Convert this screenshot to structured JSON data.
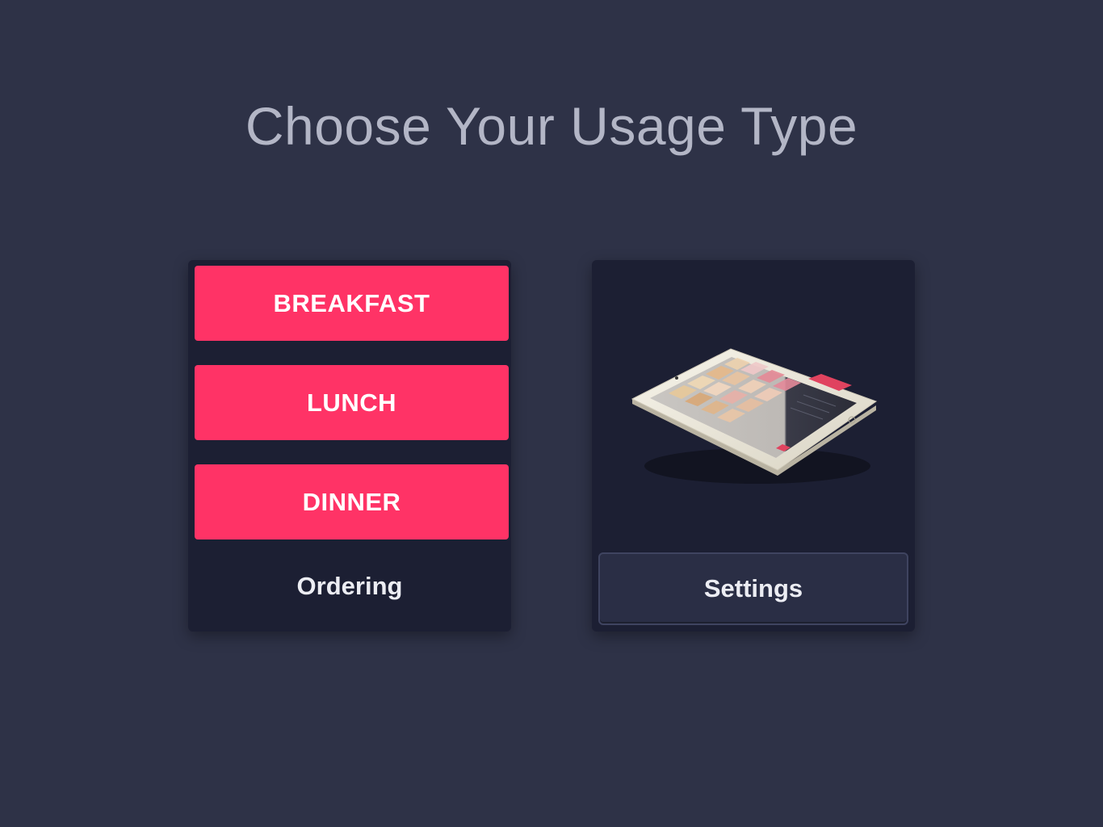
{
  "header": {
    "title": "Choose Your Usage Type"
  },
  "ordering": {
    "buttons": [
      {
        "label": "BREAKFAST"
      },
      {
        "label": "LUNCH"
      },
      {
        "label": "DINNER"
      }
    ],
    "caption": "Ordering"
  },
  "settings": {
    "image": "tablet-illustration",
    "button_label": "Settings"
  },
  "colors": {
    "background": "#2e3247",
    "card": "#1c1f33",
    "accent": "#ff3366",
    "title_text": "#b3b6c6"
  }
}
